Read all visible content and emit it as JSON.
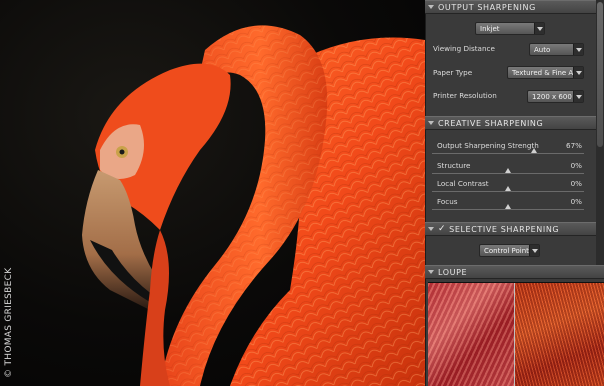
{
  "photo": {
    "copyright": "© THOMAS GRIESBECK"
  },
  "output_sharpening": {
    "header": "OUTPUT SHARPENING",
    "mode": "Inkjet",
    "rows": [
      {
        "label": "Viewing Distance",
        "value": "Auto"
      },
      {
        "label": "Paper Type",
        "value": "Textured & Fine Art"
      },
      {
        "label": "Printer Resolution",
        "value": "1200 x 600"
      }
    ]
  },
  "creative_sharpening": {
    "header": "CREATIVE SHARPENING",
    "sliders": [
      {
        "label": "Output Sharpening Strength",
        "value": "67%",
        "level": 0.67
      },
      {
        "label": "Structure",
        "value": "0%",
        "level": 0.5
      },
      {
        "label": "Local Contrast",
        "value": "0%",
        "level": 0.5
      },
      {
        "label": "Focus",
        "value": "0%",
        "level": 0.5
      }
    ]
  },
  "selective_sharpening": {
    "header": "SELECTIVE SHARPENING",
    "checked": "✓",
    "control_points": "Control Points"
  },
  "loupe": {
    "header": "LOUPE"
  }
}
